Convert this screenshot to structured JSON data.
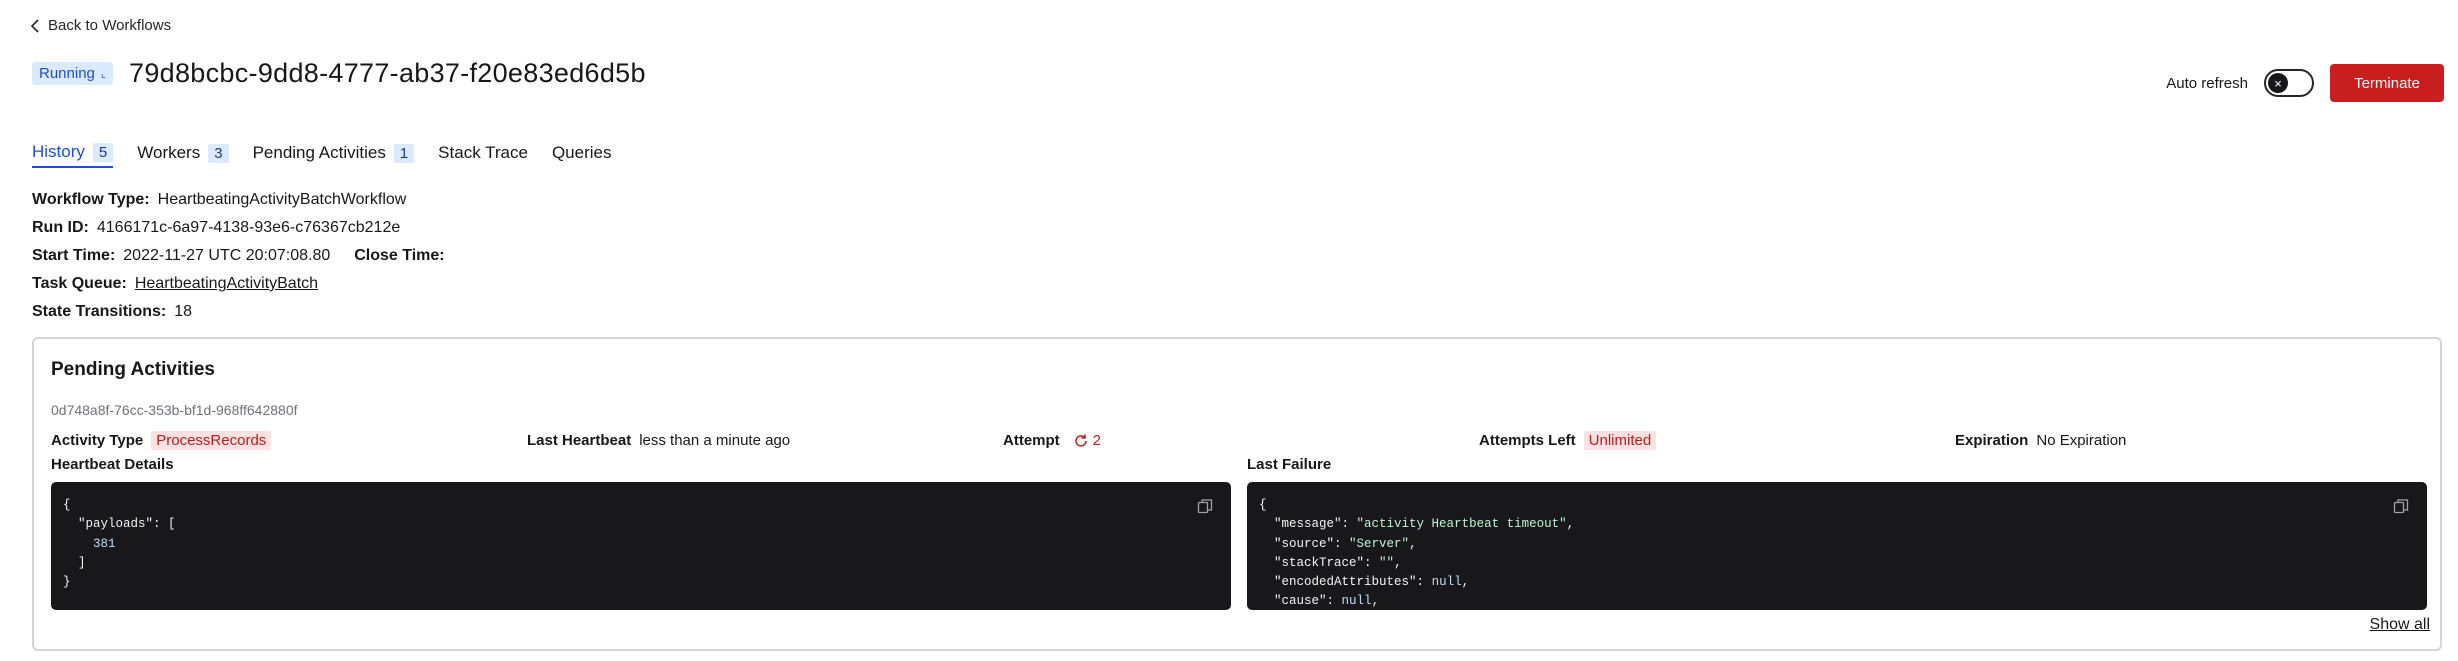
{
  "nav": {
    "back_label": "Back to Workflows"
  },
  "header": {
    "status": "Running",
    "workflow_id": "79d8bcbc-9dd8-4777-ab37-f20e83ed6d5b",
    "auto_refresh_label": "Auto refresh",
    "terminate_label": "Terminate"
  },
  "tabs": [
    {
      "label": "History",
      "count": "5",
      "active": true
    },
    {
      "label": "Workers",
      "count": "3"
    },
    {
      "label": "Pending Activities",
      "count": "1"
    },
    {
      "label": "Stack Trace"
    },
    {
      "label": "Queries"
    }
  ],
  "details": {
    "workflow_type_label": "Workflow Type:",
    "workflow_type": "HeartbeatingActivityBatchWorkflow",
    "run_id_label": "Run ID:",
    "run_id": "4166171c-6a97-4138-93e6-c76367cb212e",
    "start_time_label": "Start Time:",
    "start_time": "2022-11-27 UTC 20:07:08.80",
    "close_time_label": "Close Time:",
    "task_queue_label": "Task Queue:",
    "task_queue": "HeartbeatingActivityBatch",
    "state_transitions_label": "State Transitions:",
    "state_transitions": "18"
  },
  "pending": {
    "title": "Pending Activities",
    "activity_id": "0d748a8f-76cc-353b-bf1d-968ff642880f",
    "activity_type_label": "Activity Type",
    "activity_type": "ProcessRecords",
    "last_heartbeat_label": "Last Heartbeat",
    "last_heartbeat": "less than a minute ago",
    "attempt_label": "Attempt",
    "attempt": "2",
    "attempts_left_label": "Attempts Left",
    "attempts_left": "Unlimited",
    "expiration_label": "Expiration",
    "expiration": "No Expiration",
    "heartbeat_details_label": "Heartbeat Details",
    "last_failure_label": "Last Failure",
    "heartbeat_code": {
      "open": "{",
      "payloads_key": "\"payloads\"",
      "open_bracket": "[",
      "value": "381",
      "close_bracket": "]",
      "close": "}"
    },
    "failure_code": {
      "open": "{",
      "message_key": "\"message\"",
      "message_val": "\"activity Heartbeat timeout\"",
      "source_key": "\"source\"",
      "source_val": "\"Server\"",
      "stack_key": "\"stackTrace\"",
      "stack_val": "\"\"",
      "encoded_key": "\"encodedAttributes\"",
      "encoded_val": "null",
      "cause_key": "\"cause\"",
      "cause_val": "null"
    },
    "show_all_label": "Show all"
  }
}
